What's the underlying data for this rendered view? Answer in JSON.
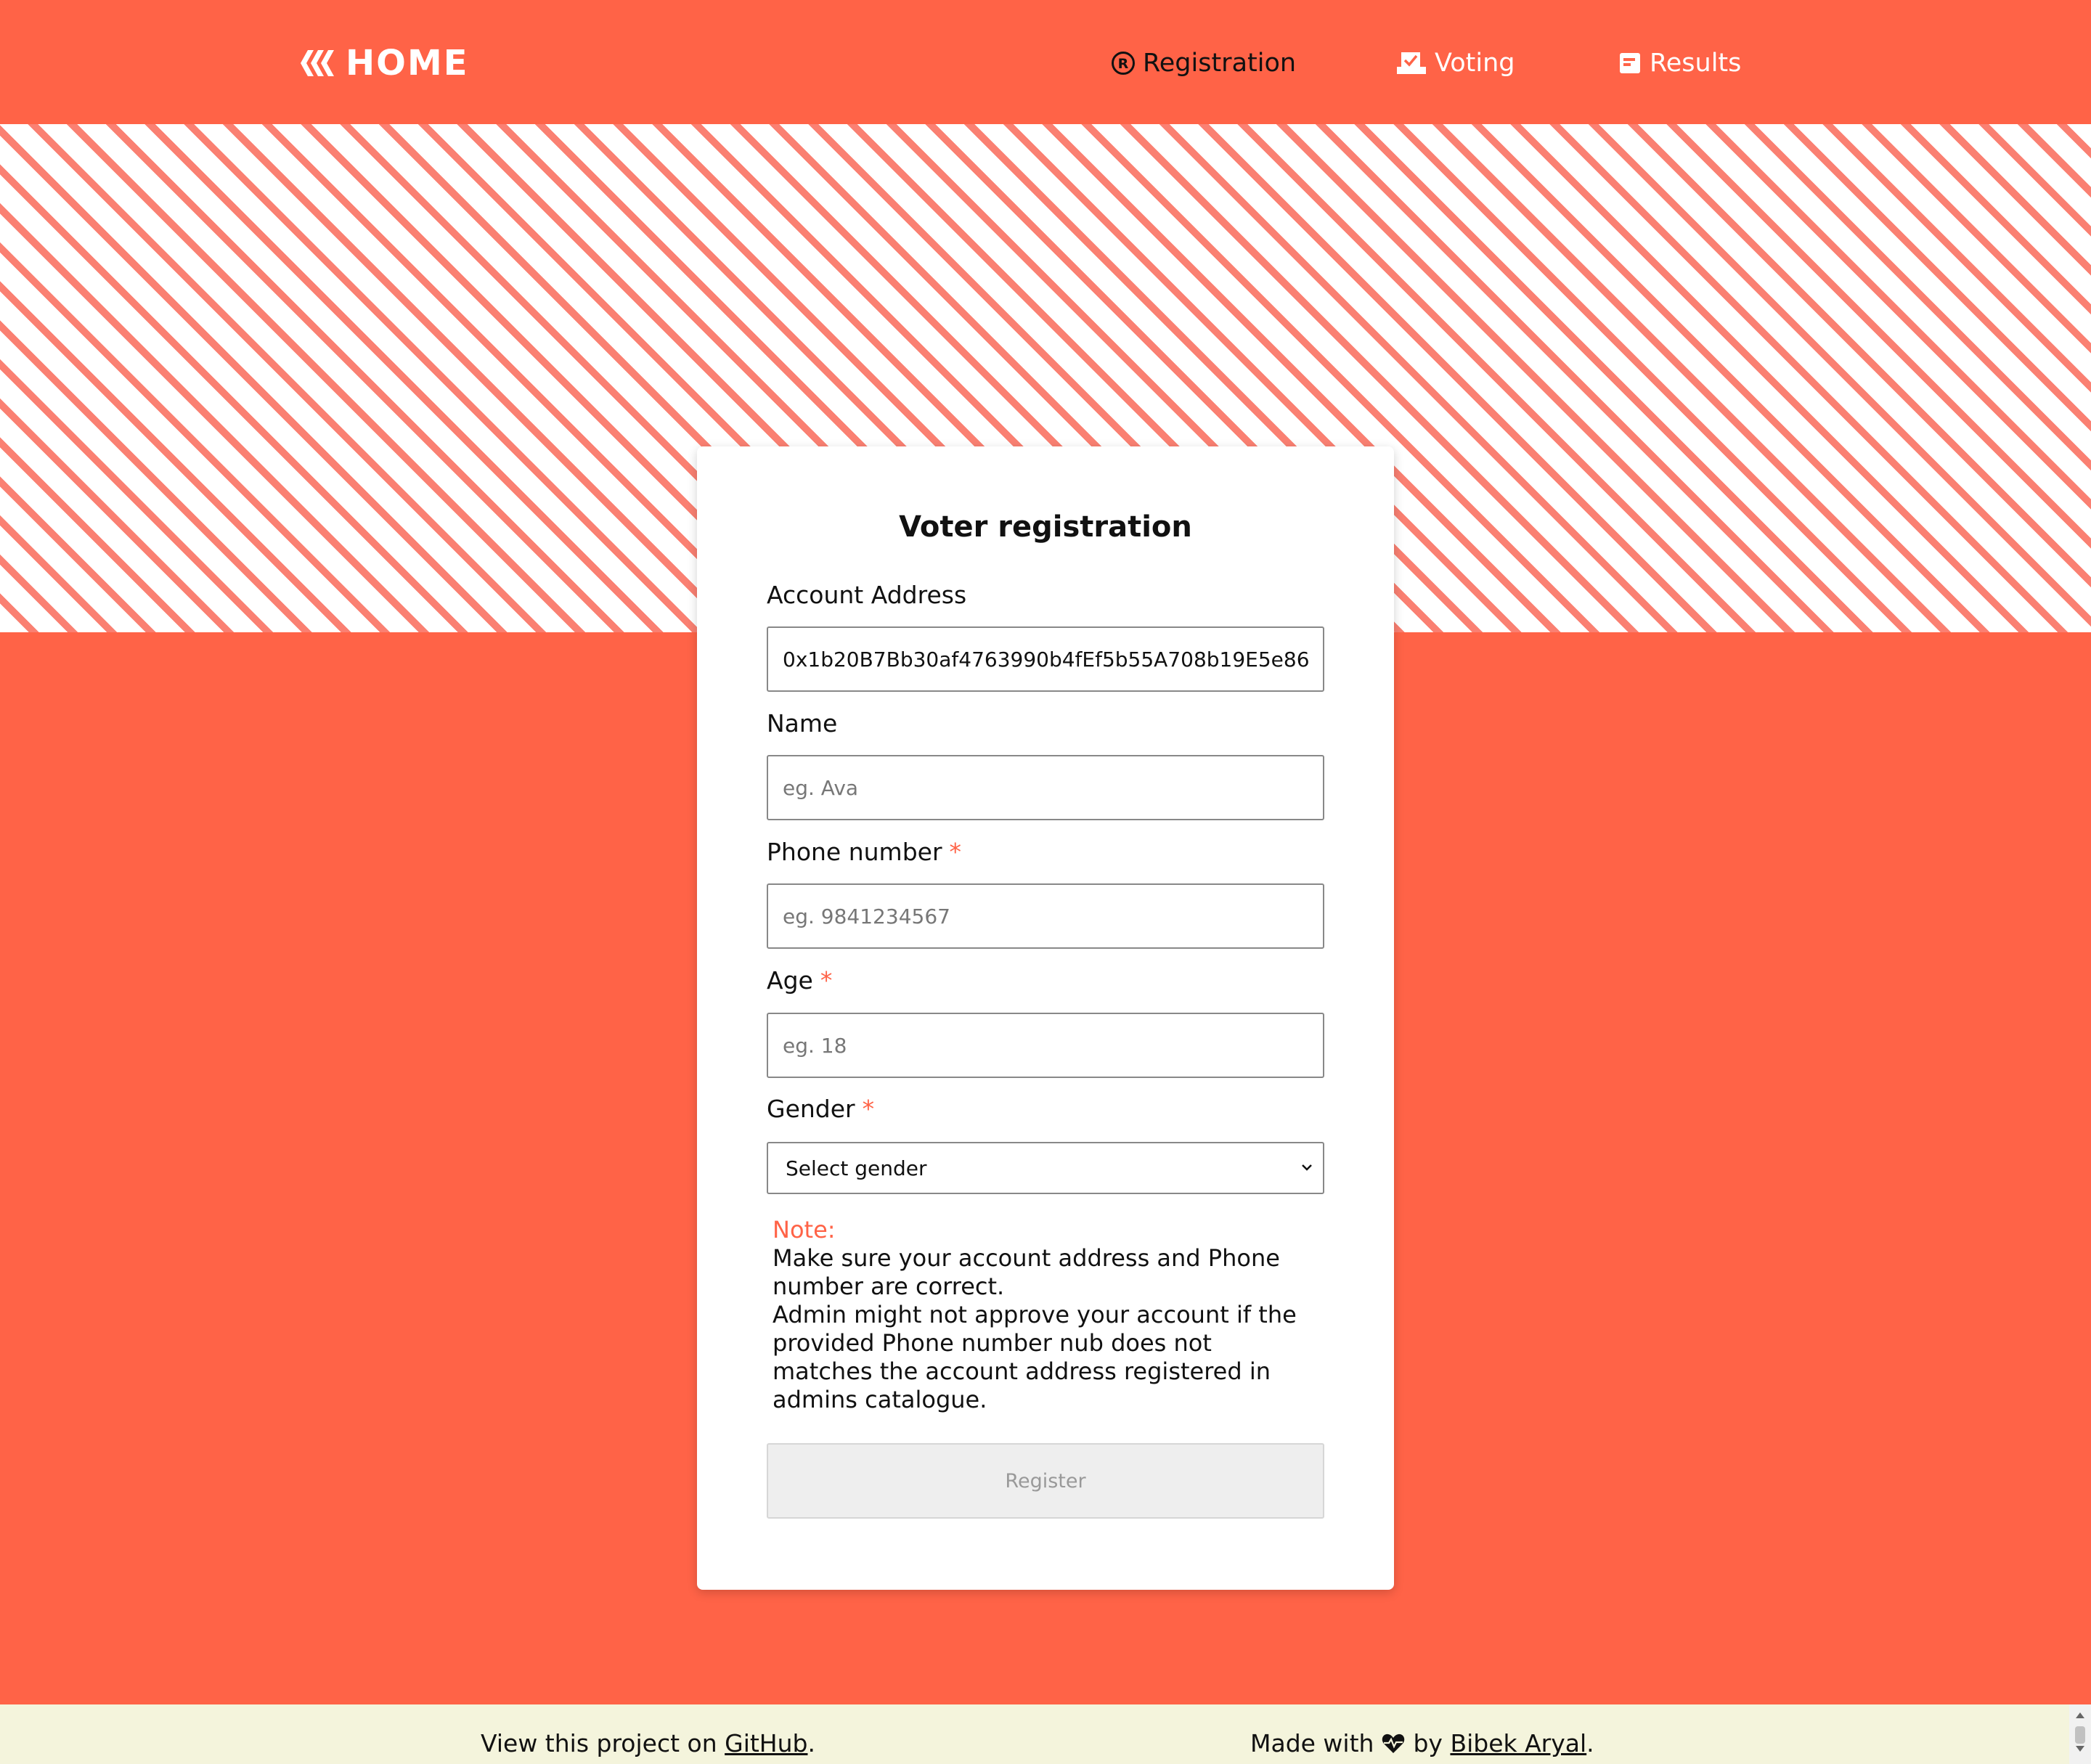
{
  "nav": {
    "brand_label": "HOME",
    "brand_icon": "hive-icon",
    "items": [
      {
        "label": "Registration",
        "icon": "registered-icon",
        "active": true
      },
      {
        "label": "Voting",
        "icon": "ballot-box-icon",
        "active": false
      },
      {
        "label": "Results",
        "icon": "poll-icon",
        "active": false
      }
    ]
  },
  "form": {
    "title": "Voter registration",
    "account_address_label": "Account Address",
    "account_address_value": "0x1b20B7Bb30af4763990b4fEf5b55A708b19E5e86",
    "name_label": "Name",
    "name_placeholder": "eg. Ava",
    "phone_label": "Phone number",
    "phone_placeholder": "eg. 9841234567",
    "age_label": "Age",
    "age_placeholder": "eg. 18",
    "gender_label": "Gender",
    "gender_selected": "Select gender",
    "required_mark": "*",
    "note_heading": "Note:",
    "note_lines": [
      "Make sure your account address and Phone",
      "number are correct.",
      "Admin might not approve your account if the",
      "provided Phone number nub does not",
      "matches the account address registered in",
      "admins catalogue."
    ],
    "register_label": "Register"
  },
  "footer": {
    "left_prefix": "View this project on ",
    "left_link": "GitHub",
    "left_suffix": ".",
    "right_prefix": "Made with",
    "right_by": "by",
    "right_link": "Bibek Aryal",
    "right_suffix": "."
  },
  "colors": {
    "primary": "#ff6347",
    "stripe": "#fa8072",
    "footer_bg": "#f4f4dc"
  }
}
